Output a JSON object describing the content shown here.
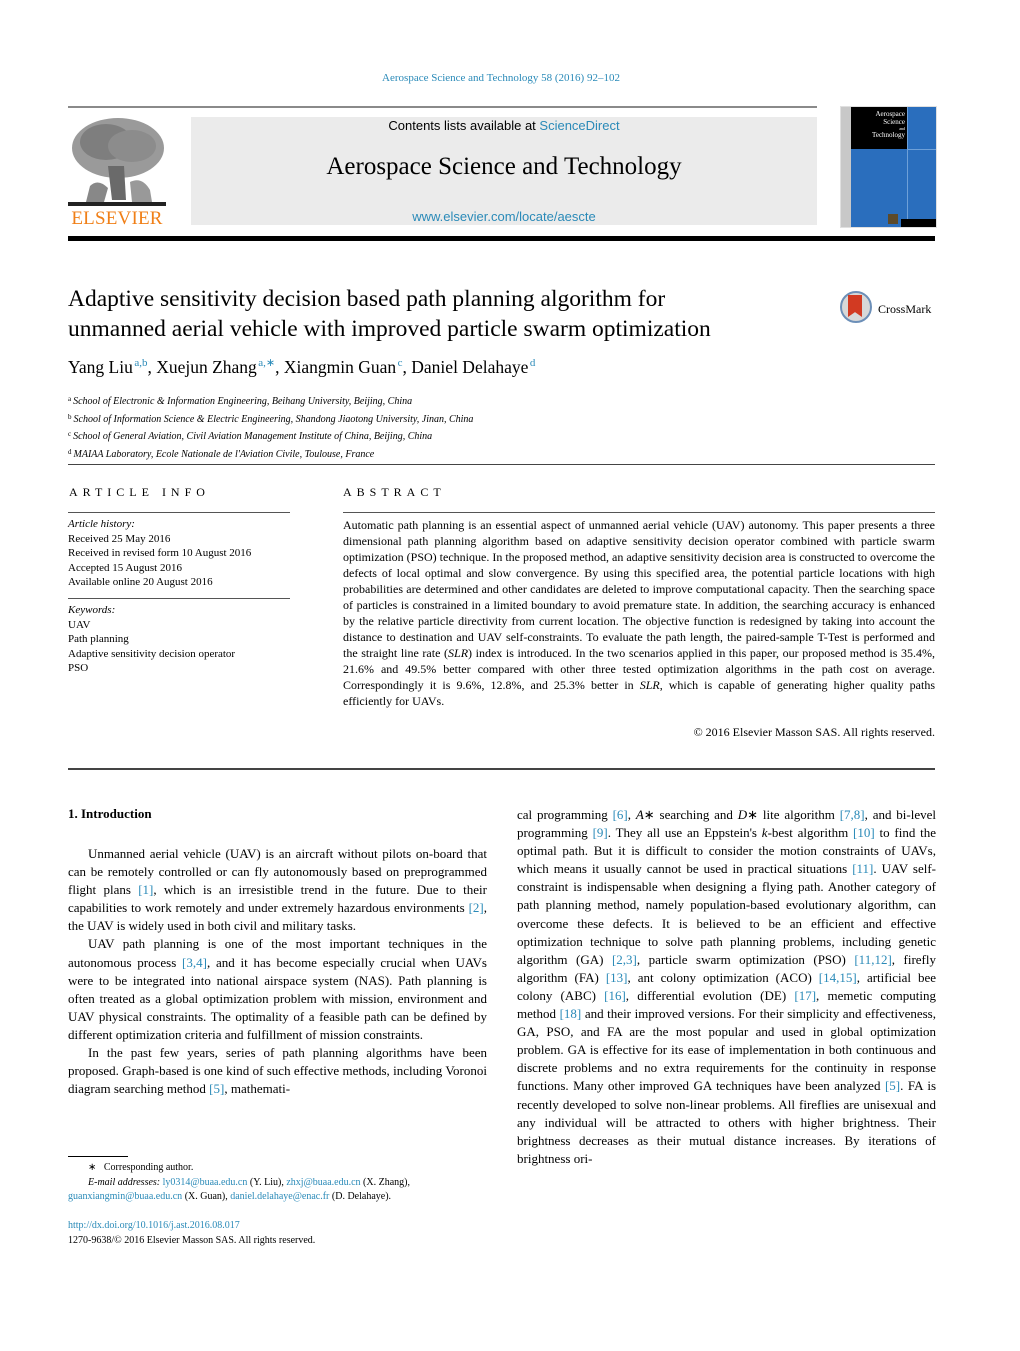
{
  "header": {
    "citation": "Aerospace Science and Technology 58 (2016) 92–102",
    "contents_prefix": "Contents lists available at ",
    "contents_link": "ScienceDirect",
    "journal_name": "Aerospace Science and Technology",
    "journal_url": "www.elsevier.com/locate/aescte",
    "publisher_logo_text": "ELSEVIER",
    "cover_title_lines": [
      "Aerospace",
      "Science",
      "and",
      "Technology"
    ],
    "colors": {
      "link": "#2a8ab8",
      "elsevier_orange": "#f07f17",
      "cover_blue": "#2a6ebd",
      "band_gray": "#ebebeb"
    }
  },
  "article": {
    "title_line1": "Adaptive sensitivity decision based path planning algorithm for",
    "title_line2": "unmanned aerial vehicle with improved particle swarm optimization",
    "crossmark_label": "CrossMark",
    "authors": [
      {
        "name": "Yang Liu",
        "sup": "a,b",
        "sep": ", "
      },
      {
        "name": "Xuejun Zhang",
        "sup": "a,∗",
        "sep": ", "
      },
      {
        "name": "Xiangmin Guan",
        "sup": "c",
        "sep": ", "
      },
      {
        "name": "Daniel Delahaye",
        "sup": "d",
        "sep": ""
      }
    ],
    "affiliations": [
      {
        "key": "a",
        "text": "School of Electronic & Information Engineering, Beihang University, Beijing, China"
      },
      {
        "key": "b",
        "text": "School of Information Science & Electric Engineering, Shandong Jiaotong University, Jinan, China"
      },
      {
        "key": "c",
        "text": "School of General Aviation, Civil Aviation Management Institute of China, Beijing, China"
      },
      {
        "key": "d",
        "text": "MAIAA Laboratory, Ecole Nationale de l'Aviation Civile, Toulouse, France"
      }
    ]
  },
  "article_info": {
    "heading": "ARTICLE INFO",
    "history_label": "Article history:",
    "history": [
      "Received 25 May 2016",
      "Received in revised form 10 August 2016",
      "Accepted 15 August 2016",
      "Available online 20 August 2016"
    ],
    "keywords_label": "Keywords:",
    "keywords": [
      "UAV",
      "Path planning",
      "Adaptive sensitivity decision operator",
      "PSO"
    ]
  },
  "abstract": {
    "heading": "ABSTRACT",
    "text_part1": "Automatic path planning is an essential aspect of unmanned aerial vehicle (UAV) autonomy. This paper presents a three dimensional path planning algorithm based on adaptive sensitivity decision operator combined with particle swarm optimization (PSO) technique. In the proposed method, an adaptive sensitivity decision area is constructed to overcome the defects of local optimal and slow convergence. By using this specified area, the potential particle locations with high probabilities are determined and other candidates are deleted to improve computational capacity. Then the searching space of particles is constrained in a limited boundary to avoid premature state. In addition, the searching accuracy is enhanced by the relative particle directivity from current location. The objective function is redesigned by taking into account the distance to destination and UAV self-constraints. To evaluate the path length, the paired-sample T-Test is performed and the straight line rate (",
    "slr1": "SLR",
    "text_part2": ") index is introduced. In the two scenarios applied in this paper, our proposed method is 35.4%, 21.6% and 49.5% better compared with other three tested optimization algorithms in the path cost on average. Correspondingly it is 9.6%, 12.8%, and 25.3% better in ",
    "slr2": "SLR",
    "text_part3": ", which is capable of generating higher quality paths efficiently for UAVs.",
    "copyright": "© 2016 Elsevier Masson SAS. All rights reserved."
  },
  "body": {
    "section_heading": "1.  Introduction",
    "left_paragraphs": [
      [
        {
          "t": "Unmanned aerial vehicle (UAV) is an aircraft without pilots on-board that can be remotely controlled or can fly autonomously based on preprogrammed flight plans "
        },
        {
          "ref": "[1]"
        },
        {
          "t": ", which is an irresistible trend in the future. Due to their capabilities to work remotely and under extremely hazardous environments "
        },
        {
          "ref": "[2]"
        },
        {
          "t": ", the UAV is widely used in both civil and military tasks."
        }
      ],
      [
        {
          "t": "UAV path planning is one of the most important techniques in the autonomous process "
        },
        {
          "ref": "[3,4]"
        },
        {
          "t": ", and it has become especially crucial when UAVs were to be integrated into national airspace system (NAS). Path planning is often treated as a global optimization problem with mission, environment and UAV physical constraints. The optimality of a feasible path can be defined by different optimization criteria and fulfillment of mission constraints."
        }
      ],
      [
        {
          "t": "In the past few years, series of path planning algorithms have been proposed. Graph-based is one kind of such effective methods, including Voronoi diagram searching method "
        },
        {
          "ref": "[5]"
        },
        {
          "t": ", mathemati-"
        }
      ]
    ],
    "right_paragraph": [
      {
        "t": "cal programming "
      },
      {
        "ref": "[6]"
      },
      {
        "t": ", "
      },
      {
        "i": "A"
      },
      {
        "t": "∗ searching and "
      },
      {
        "i": "D"
      },
      {
        "t": "∗ lite algorithm "
      },
      {
        "ref": "[7,8]"
      },
      {
        "t": ", and bi-level programming "
      },
      {
        "ref": "[9]"
      },
      {
        "t": ". They all use an Eppstein's "
      },
      {
        "i": "k"
      },
      {
        "t": "-best algorithm "
      },
      {
        "ref": "[10]"
      },
      {
        "t": " to find the optimal path. But it is difficult to consider the motion constraints of UAVs, which means it usually cannot be used in practical situations "
      },
      {
        "ref": "[11]"
      },
      {
        "t": ". UAV self-constraint is indispensable when designing a flying path. Another category of path planning method, namely population-based evolutionary algorithm, can overcome these defects. It is believed to be an efficient and effective optimization technique to solve path planning problems, including genetic algorithm (GA) "
      },
      {
        "ref": "[2,3]"
      },
      {
        "t": ", particle swarm optimization (PSO) "
      },
      {
        "ref": "[11,12]"
      },
      {
        "t": ", firefly algorithm (FA) "
      },
      {
        "ref": "[13]"
      },
      {
        "t": ", ant colony optimization (ACO) "
      },
      {
        "ref": "[14,15]"
      },
      {
        "t": ", artificial bee colony (ABC) "
      },
      {
        "ref": "[16]"
      },
      {
        "t": ", differential evolution (DE) "
      },
      {
        "ref": "[17]"
      },
      {
        "t": ", memetic computing method "
      },
      {
        "ref": "[18]"
      },
      {
        "t": " and their improved versions. For their simplicity and effectiveness, GA, PSO, and FA are the most popular and used in global optimization problem. GA is effective for its ease of implementation in both continuous and discrete problems and no extra requirements for the continuity in response functions. Many other improved GA techniques have been analyzed "
      },
      {
        "ref": "[5]"
      },
      {
        "t": ". FA is recently developed to solve non-linear problems. All fireflies are unisexual and any individual will be attracted to others with higher brightness. Their brightness decreases as their mutual distance increases. By iterations of brightness ori-"
      }
    ]
  },
  "footnotes": {
    "corresponding_mark": "∗",
    "corresponding_text": "Corresponding author.",
    "email_label": "E-mail addresses:",
    "emails": [
      {
        "email": "ly0314@buaa.edu.cn",
        "who": " (Y. Liu), "
      },
      {
        "email": "zhxj@buaa.edu.cn",
        "who": " (X. Zhang),"
      },
      {
        "email": "guanxiangmin@buaa.edu.cn",
        "who": " (X. Guan), "
      },
      {
        "email": "daniel.delahaye@enac.fr",
        "who": " (D. Delahaye)."
      }
    ],
    "doi": "http://dx.doi.org/10.1016/j.ast.2016.08.017",
    "issn_line": "1270-9638/© 2016 Elsevier Masson SAS. All rights reserved."
  }
}
